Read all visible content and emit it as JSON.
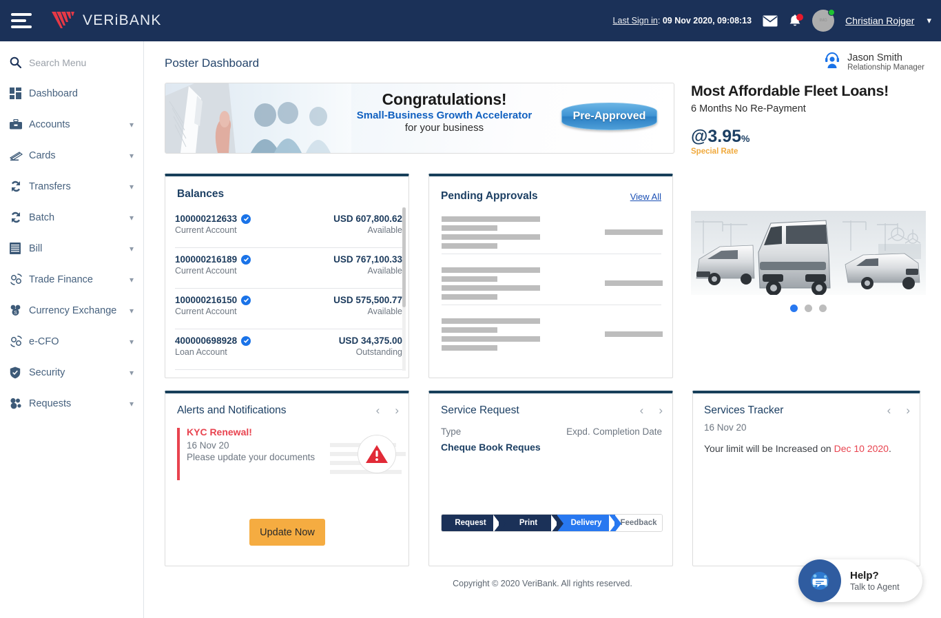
{
  "header": {
    "brand_name": "VERiBANK",
    "last_sign_label": "Last Sign in",
    "last_sign_value": "09 Nov 2020, 09:08:13",
    "user_name": "Christian Rojger",
    "mail_icon": "envelope-icon",
    "bell_icon": "bell-icon",
    "caret_icon": "chevron-down-icon"
  },
  "sidebar": {
    "search_placeholder": "Search Menu",
    "items": [
      {
        "label": "Dashboard",
        "icon": "grid-icon",
        "expandable": false
      },
      {
        "label": "Accounts",
        "icon": "briefcase-icon",
        "expandable": true
      },
      {
        "label": "Cards",
        "icon": "card-icon",
        "expandable": true
      },
      {
        "label": "Transfers",
        "icon": "transfer-icon",
        "expandable": true
      },
      {
        "label": "Batch",
        "icon": "batch-icon",
        "expandable": true
      },
      {
        "label": "Bill",
        "icon": "bill-icon",
        "expandable": true
      },
      {
        "label": "Trade Finance",
        "icon": "trade-icon",
        "expandable": true
      },
      {
        "label": "Currency Exchange",
        "icon": "coins-icon",
        "expandable": true
      },
      {
        "label": "e-CFO",
        "icon": "ecfo-icon",
        "expandable": true
      },
      {
        "label": "Security",
        "icon": "shield-icon",
        "expandable": true
      },
      {
        "label": "Requests",
        "icon": "requests-icon",
        "expandable": true
      }
    ]
  },
  "main": {
    "page_title": "Poster Dashboard",
    "relationship_manager": {
      "name": "Jason Smith",
      "role": "Relationship Manager"
    },
    "banner": {
      "headline": "Congratulations!",
      "subhead": "Small-Business Growth Accelerator",
      "tagline": "for your business",
      "button": "Pre-Approved"
    },
    "balances": {
      "title": "Balances",
      "rows": [
        {
          "account": "100000212633",
          "type": "Current Account",
          "amount": "USD 607,800.62",
          "status": "Available",
          "verified": true
        },
        {
          "account": "100000216189",
          "type": "Current Account",
          "amount": "USD 767,100.33",
          "status": "Available",
          "verified": true
        },
        {
          "account": "100000216150",
          "type": "Current Account",
          "amount": "USD 575,500.77",
          "status": "Available",
          "verified": true
        },
        {
          "account": "400000698928",
          "type": "Loan Account",
          "amount": "USD 34,375.00",
          "status": "Outstanding",
          "verified": true
        }
      ]
    },
    "pending_approvals": {
      "title": "Pending Approvals",
      "view_all": "View All",
      "placeholder_groups": 3
    },
    "alerts": {
      "title": "Alerts and Notifications",
      "alert_title": "KYC Renewal!",
      "alert_date": "16 Nov 20",
      "alert_text": "Please update your documents",
      "button": "Update Now",
      "icon": "warning-triangle-icon",
      "prev_icon": "chevron-left-icon",
      "next_icon": "chevron-right-icon"
    },
    "service_request": {
      "title": "Service Request",
      "type_label": "Type",
      "date_label": "Expd. Completion Date",
      "type_value": "Cheque Book Reques",
      "steps": [
        {
          "label": "Request",
          "state": "done"
        },
        {
          "label": "Print",
          "state": "done"
        },
        {
          "label": "Delivery",
          "state": "current"
        },
        {
          "label": "Feedback",
          "state": "todo"
        }
      ]
    },
    "services_tracker": {
      "title": "Services Tracker",
      "date": "16 Nov 20",
      "message_prefix": "Your limit will be Increased on ",
      "message_highlight": "Dec 10 2020",
      "message_suffix": "."
    },
    "promo": {
      "headline": "Most Affordable Fleet Loans!",
      "subhead": "6 Months No Re-Payment",
      "rate": "@3.95",
      "rate_unit": "%",
      "rate_note": "Special Rate",
      "dots": 3,
      "active_dot": 0
    }
  },
  "footer": {
    "copyright": "Copyright © 2020 VeriBank. All rights reserved."
  },
  "help_widget": {
    "title": "Help?",
    "subtitle": "Talk to Agent",
    "icon": "chat-bubble-icon"
  },
  "colors": {
    "header_navy": "#1b3158",
    "card_border_top": "#173f5a",
    "brand_red": "#e63946",
    "accent_blue": "#2878f0",
    "alert_red": "#e8434f",
    "warn_orange": "#f5ac41",
    "link_blue": "#1a4fb4"
  }
}
